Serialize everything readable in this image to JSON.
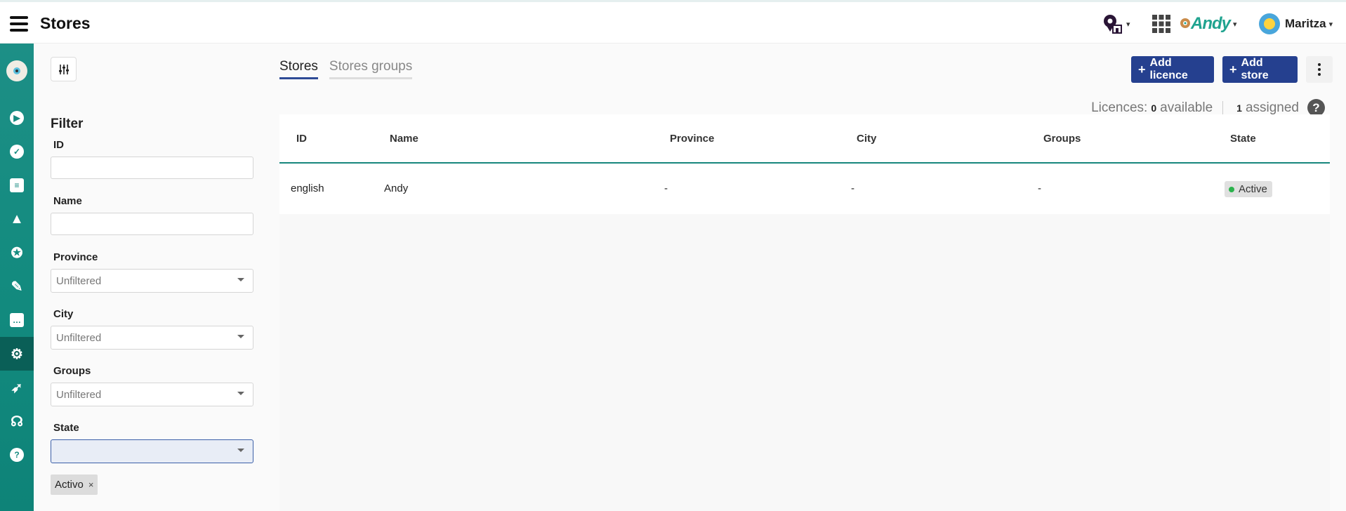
{
  "header": {
    "title": "Stores",
    "brand": "Andy",
    "user": "Maritza"
  },
  "sidebar": {
    "items": [
      {
        "icon": "play-icon"
      },
      {
        "icon": "check-icon"
      },
      {
        "icon": "clipboard-icon"
      },
      {
        "icon": "warning-icon"
      },
      {
        "icon": "award-icon"
      },
      {
        "icon": "ticket-icon"
      },
      {
        "icon": "chat-icon"
      },
      {
        "icon": "settings-icon",
        "active": true
      },
      {
        "icon": "rocket-icon"
      },
      {
        "icon": "headset-icon"
      },
      {
        "icon": "help-icon"
      }
    ]
  },
  "filter": {
    "title": "Filter",
    "id_label": "ID",
    "id_value": "",
    "name_label": "Name",
    "name_value": "",
    "province_label": "Province",
    "province_value": "Unfiltered",
    "city_label": "City",
    "city_value": "Unfiltered",
    "groups_label": "Groups",
    "groups_value": "Unfiltered",
    "state_label": "State",
    "state_value": "",
    "state_tag": "Activo",
    "tag_remove": "×"
  },
  "tabs": [
    {
      "label": "Stores",
      "active": true
    },
    {
      "label": "Stores groups",
      "active": false
    }
  ],
  "actions": {
    "add_licence": "Add licence",
    "add_store": "Add store",
    "plus": "+"
  },
  "licences": {
    "label": "Licences:",
    "available_count": "0",
    "available_label": "available",
    "assigned_count": "1",
    "assigned_label": "assigned",
    "help": "?"
  },
  "table": {
    "columns": [
      "ID",
      "Name",
      "Province",
      "City",
      "Groups",
      "State"
    ],
    "rows": [
      {
        "id": "english",
        "name": "Andy",
        "province": "-",
        "city": "-",
        "groups": "-",
        "state": "Active"
      }
    ]
  },
  "colors": {
    "primary_button": "#25408f",
    "sidebar": "#168a80",
    "status_active": "#2bb24c"
  }
}
